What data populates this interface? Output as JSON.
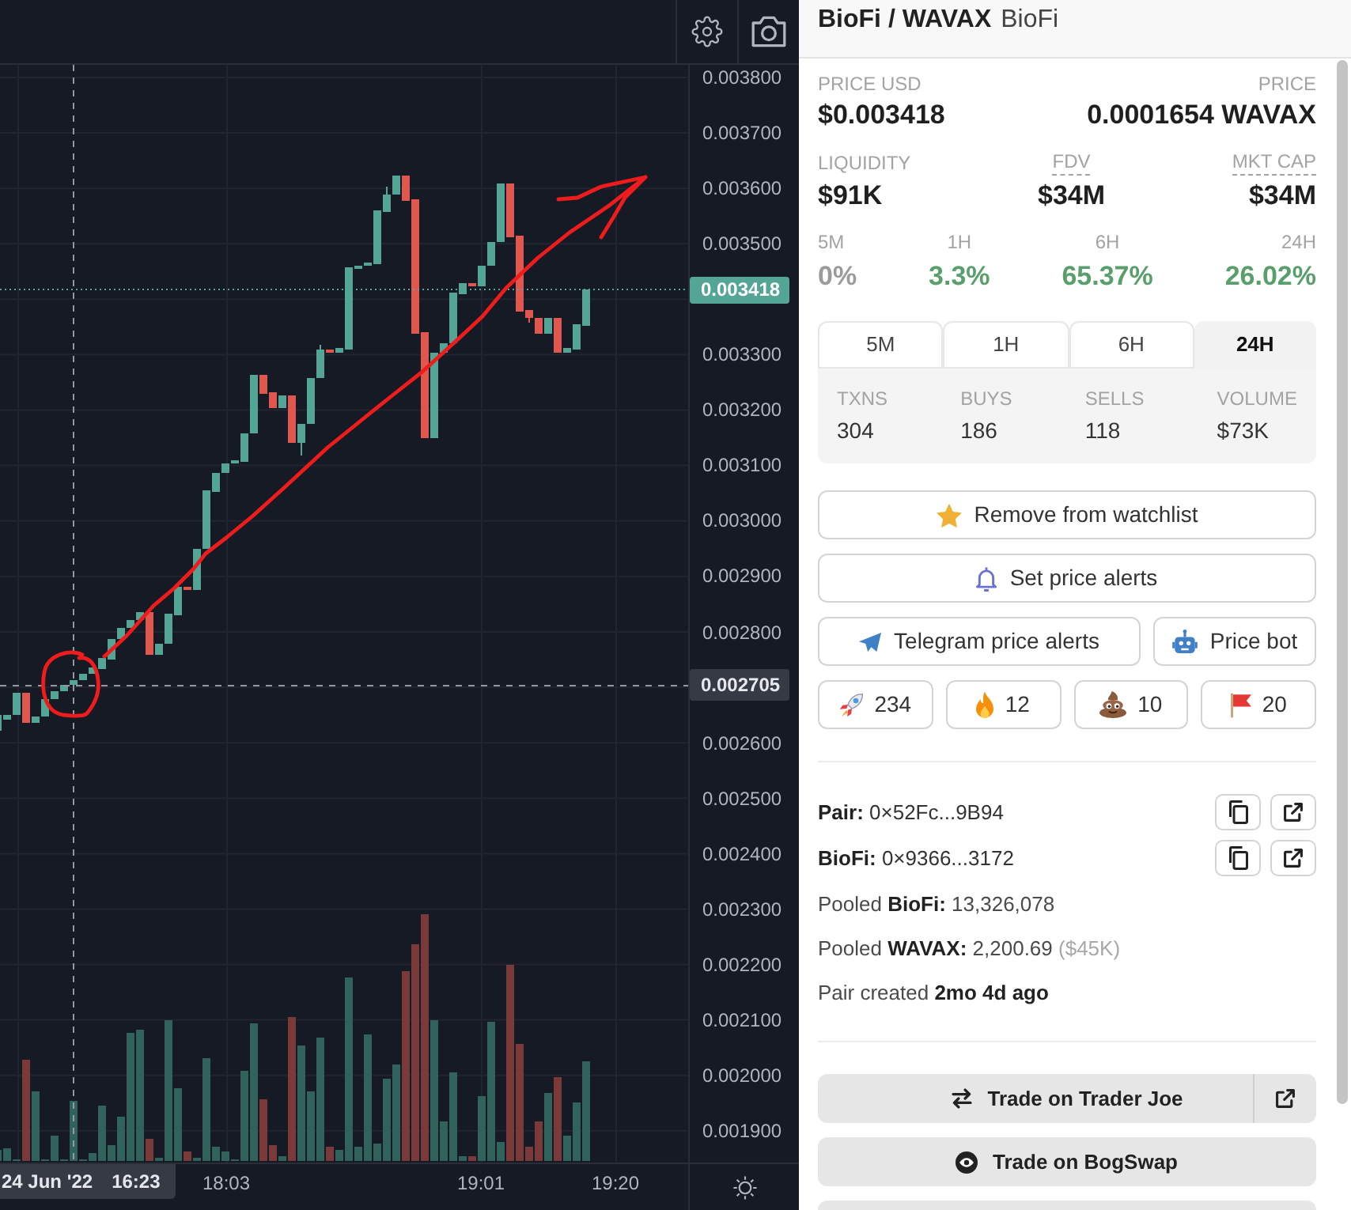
{
  "chart": {
    "price_axis": [
      {
        "kind": "tick",
        "label": "0.003800"
      },
      {
        "kind": "tick",
        "label": "0.003700"
      },
      {
        "kind": "tick",
        "label": "0.003600"
      },
      {
        "kind": "tick",
        "label": "0.003500"
      },
      {
        "kind": "last_price",
        "label": "0.003418"
      },
      {
        "kind": "tick",
        "label": "0.003300"
      },
      {
        "kind": "tick",
        "label": "0.003200"
      },
      {
        "kind": "tick",
        "label": "0.003100"
      },
      {
        "kind": "tick",
        "label": "0.003000"
      },
      {
        "kind": "tick",
        "label": "0.002900"
      },
      {
        "kind": "tick",
        "label": "0.002800"
      },
      {
        "kind": "crosshair",
        "label": "0.002705"
      },
      {
        "kind": "tick",
        "label": "0.002600"
      },
      {
        "kind": "tick",
        "label": "0.002500"
      },
      {
        "kind": "tick",
        "label": "0.002400"
      },
      {
        "kind": "tick",
        "label": "0.002300"
      },
      {
        "kind": "tick",
        "label": "0.002200"
      },
      {
        "kind": "tick",
        "label": "0.002100"
      },
      {
        "kind": "tick",
        "label": "0.002000"
      },
      {
        "kind": "tick",
        "label": "0.001900"
      }
    ],
    "time_axis": {
      "crosshair_date": "24 Jun '22",
      "crosshair_time": "16:23",
      "labels": [
        "18:03",
        "19:01",
        "19:20"
      ]
    }
  },
  "header": {
    "pair": "BioFi / WAVAX",
    "subtitle": "BioFi"
  },
  "prices": [
    {
      "label": "PRICE USD",
      "value": "$0.003418"
    },
    {
      "label": "PRICE",
      "value": "0.0001654 WAVAX"
    }
  ],
  "stats": [
    {
      "label": "LIQUIDITY",
      "value": "$91K",
      "underlined": false
    },
    {
      "label": "FDV",
      "value": "$34M",
      "underlined": true
    },
    {
      "label": "MKT CAP",
      "value": "$34M",
      "underlined": true
    }
  ],
  "changes": [
    {
      "period": "5M",
      "value": "0%",
      "color": "#9b9b9b"
    },
    {
      "period": "1H",
      "value": "3.3%",
      "color": "#589f6c"
    },
    {
      "period": "6H",
      "value": "65.37%",
      "color": "#589f6c"
    },
    {
      "period": "24H",
      "value": "26.02%",
      "color": "#589f6c"
    }
  ],
  "period_tabs": [
    {
      "label": "5M",
      "selected": false
    },
    {
      "label": "1H",
      "selected": false
    },
    {
      "label": "6H",
      "selected": false
    },
    {
      "label": "24H",
      "selected": true
    }
  ],
  "txn_stats": [
    {
      "label": "TXNS",
      "value": "304"
    },
    {
      "label": "BUYS",
      "value": "186"
    },
    {
      "label": "SELLS",
      "value": "118"
    },
    {
      "label": "VOLUME",
      "value": "$73K"
    }
  ],
  "action_rows": [
    [
      {
        "kind": "watchlist",
        "label": "Remove from watchlist"
      }
    ],
    [
      {
        "kind": "alerts",
        "label": "Set price alerts"
      }
    ],
    [
      {
        "kind": "telegram",
        "label": "Telegram price alerts"
      },
      {
        "kind": "bot",
        "label": "Price bot"
      }
    ]
  ],
  "reactions": [
    {
      "kind": "rocket",
      "count": "234"
    },
    {
      "kind": "fire",
      "count": "12"
    },
    {
      "kind": "poop",
      "count": "10"
    },
    {
      "kind": "flag",
      "count": "20"
    }
  ],
  "addresses": [
    {
      "text": "**Pair:** 0×52Fc...9B94"
    },
    {
      "text": "**BioFi:** 0×9366...3172"
    }
  ],
  "details": [
    {
      "text": "Pooled **BioFi:** 13,326,078"
    },
    {
      "text": "Pooled **WAVAX:** 2,200.69",
      "note": "($45K)"
    },
    {
      "text": "Pair created **2mo 4d ago**"
    }
  ],
  "trade_buttons": [
    {
      "kind": "swap",
      "label": "Trade on Trader Joe",
      "external": true
    },
    {
      "kind": "bogswap",
      "label": "Trade on BogSwap",
      "external": false
    }
  ]
}
